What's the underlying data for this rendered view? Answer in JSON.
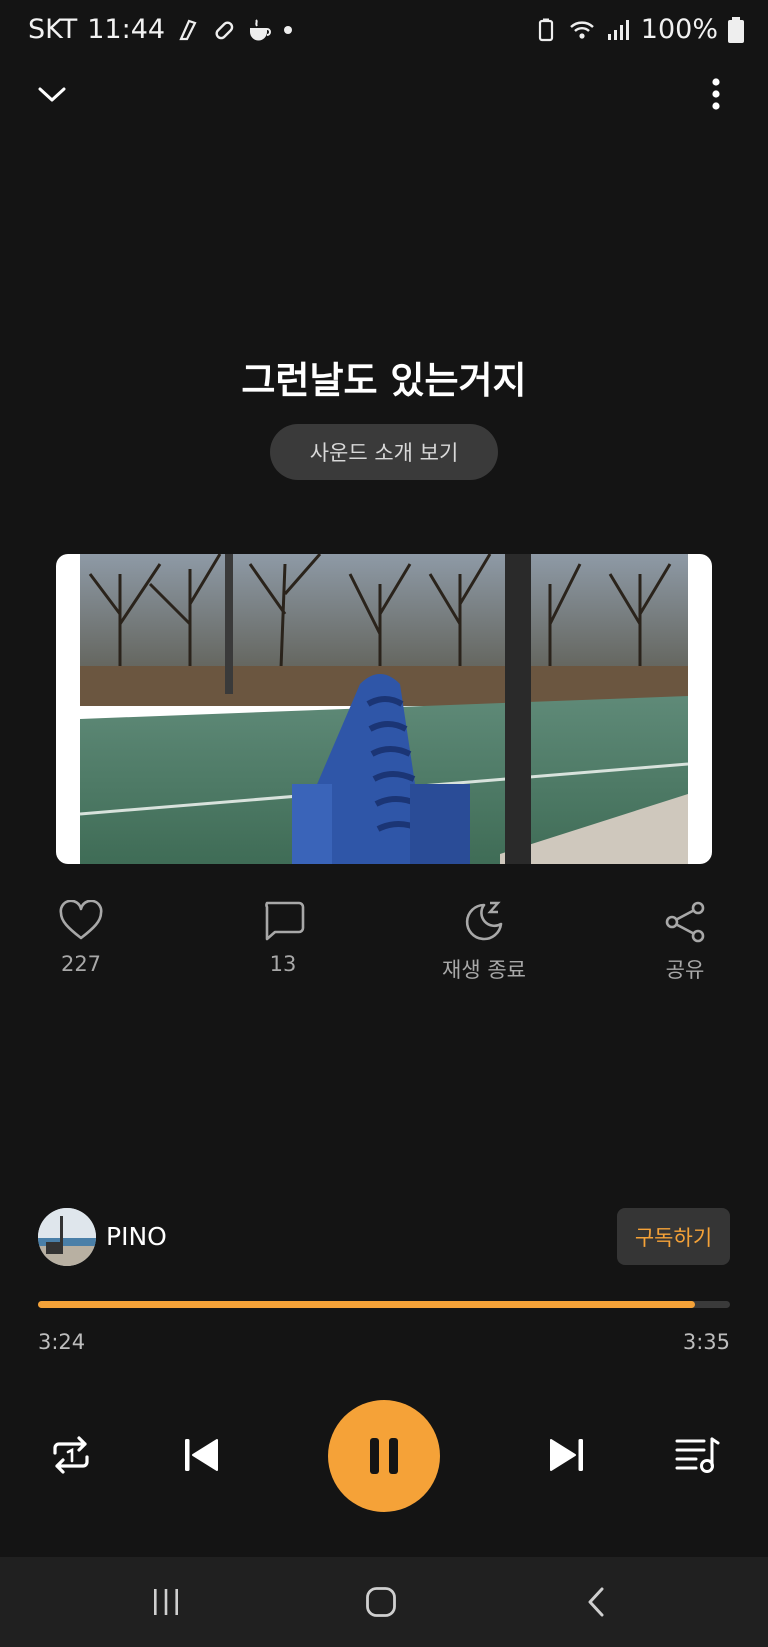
{
  "status_bar": {
    "carrier": "SKT",
    "time": "11:44",
    "battery": "100%"
  },
  "track": {
    "title": "그런날도 있는거지",
    "intro_button": "사운드 소개 보기"
  },
  "actions": [
    {
      "icon": "heart-icon",
      "label": "227"
    },
    {
      "icon": "comment-icon",
      "label": "13"
    },
    {
      "icon": "moon-icon",
      "label": "재생 종료"
    },
    {
      "icon": "share-icon",
      "label": "공유"
    }
  ],
  "artist": {
    "name": "PINO",
    "subscribe_label": "구독하기"
  },
  "progress": {
    "elapsed": "3:24",
    "total": "3:35",
    "fraction": 0.949
  },
  "colors": {
    "background": "#141414",
    "accent": "#f5a238",
    "navbar": "#202020"
  },
  "icons": {
    "top_left": "chevron-down-icon",
    "top_right": "more-vertical-icon",
    "controls": [
      "repeat-one-icon",
      "skip-previous-icon",
      "pause-icon",
      "skip-next-icon",
      "playlist-icon"
    ],
    "nav": [
      "recent-apps-icon",
      "home-icon",
      "back-icon"
    ]
  }
}
